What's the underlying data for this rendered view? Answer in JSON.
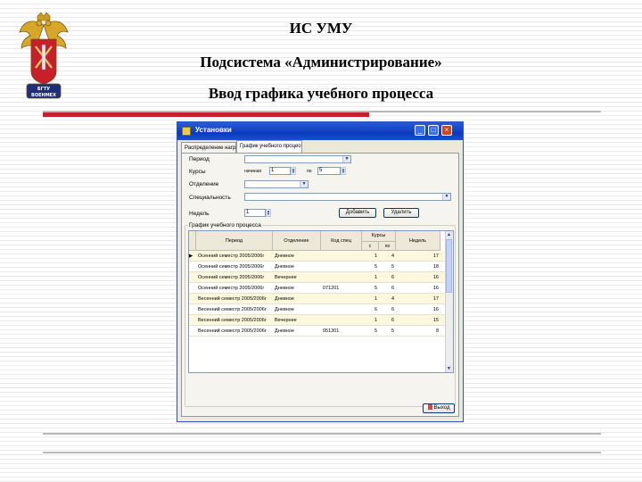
{
  "slide": {
    "title": "ИС УМУ",
    "subtitle": "Подсистема «Администрирование»",
    "heading": "Ввод графика учебного процесса",
    "logo_text": "БГТУ ВОЕНМЕХ"
  },
  "window": {
    "title": "Установки",
    "min": "_",
    "max": "□",
    "close": "×",
    "tabs": [
      "Распределение нагрузки",
      "График учебного процесса"
    ],
    "labels": {
      "period": "Период",
      "courses": "Курсы",
      "course_from": "начиная",
      "course_to": "по",
      "department": "Отделение",
      "specialty": "Специальность",
      "weeks": "Недель"
    },
    "values": {
      "course_from": "1",
      "course_to": "5",
      "weeks": "1"
    },
    "buttons": {
      "add": "Добавить",
      "delete": "Удалить",
      "exit": "Выход"
    },
    "group_title": "График учебного процесса",
    "columns": [
      "Период",
      "Отделение",
      "Код спец",
      "Курсы",
      "Недель"
    ],
    "subcolumns": [
      "с",
      "по"
    ],
    "rows": [
      {
        "marker": "▶",
        "period": "Осенний семестр 2005/2006г",
        "dept": "Дневное",
        "code": "",
        "from": "1",
        "to": "4",
        "weeks": "17"
      },
      {
        "marker": "",
        "period": "Осенний семестр 2005/2006г",
        "dept": "Дневное",
        "code": "",
        "from": "5",
        "to": "5",
        "weeks": "18"
      },
      {
        "marker": "",
        "period": "Осенний семестр 2005/2006г",
        "dept": "Вечернее",
        "code": "",
        "from": "1",
        "to": "6",
        "weeks": "16"
      },
      {
        "marker": "",
        "period": "Осенний семестр 2005/2006г",
        "dept": "Дневное",
        "code": "071201",
        "from": "5",
        "to": "6",
        "weeks": "16"
      },
      {
        "marker": "",
        "period": "Весенний семестр 2005/2006г",
        "dept": "Дневное",
        "code": "",
        "from": "1",
        "to": "4",
        "weeks": "17"
      },
      {
        "marker": "",
        "period": "Весенний семестр 2005/2006г",
        "dept": "Дневное",
        "code": "",
        "from": "6",
        "to": "6",
        "weeks": "16"
      },
      {
        "marker": "",
        "period": "Весенний семестр 2005/2006г",
        "dept": "Вечернее",
        "code": "",
        "from": "1",
        "to": "6",
        "weeks": "15"
      },
      {
        "marker": "",
        "period": "Весенний семестр 2005/2006г",
        "dept": "Дневное",
        "code": "051301",
        "from": "5",
        "to": "5",
        "weeks": "8"
      }
    ]
  },
  "colors": {
    "accent_red": "#c8202b",
    "titlebar_blue": "#0b3bbd",
    "grid_row": "#fbf8dd"
  }
}
